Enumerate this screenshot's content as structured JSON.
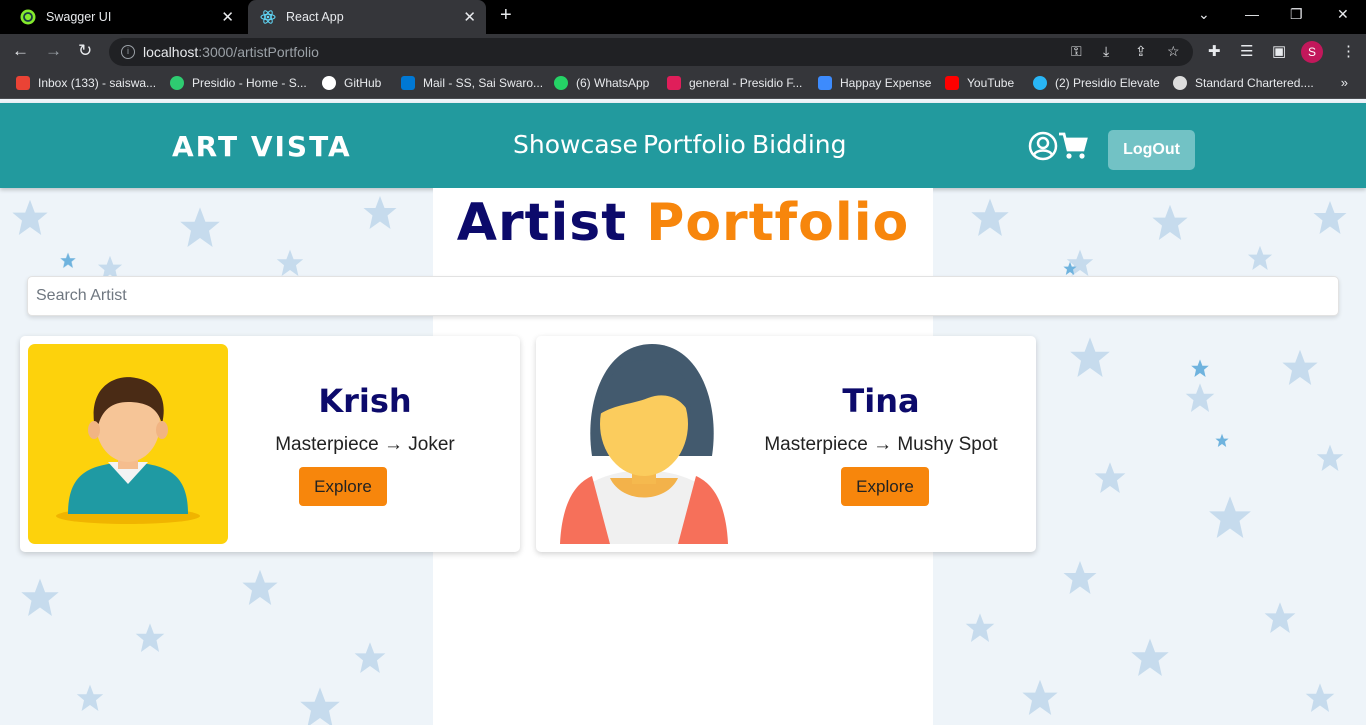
{
  "browser": {
    "tabs": [
      {
        "title": "Swagger UI",
        "close": "✕"
      },
      {
        "title": "React App",
        "close": "✕"
      }
    ],
    "new_tab": "+",
    "window_controls": {
      "dropdown": "⌄",
      "minimize": "—",
      "restore": "❐",
      "close": "✕"
    },
    "url": {
      "host": "localhost",
      "path": ":3000/artistPortfolio"
    },
    "profile_initial": "S",
    "bookmarks": [
      {
        "label": "Inbox (133) - saiswa...",
        "color": "#ea4335"
      },
      {
        "label": "Presidio - Home - S...",
        "color": "#2ecc71"
      },
      {
        "label": "GitHub",
        "color": "#ffffff"
      },
      {
        "label": "Mail - SS, Sai Swaro...",
        "color": "#0078d4"
      },
      {
        "label": "(6) WhatsApp",
        "color": "#25d366"
      },
      {
        "label": "general - Presidio F...",
        "color": "#e01e5a"
      },
      {
        "label": "Happay Expense",
        "color": "#3d8bfd"
      },
      {
        "label": "YouTube",
        "color": "#ff0000"
      },
      {
        "label": "(2) Presidio Elevate",
        "color": "#29b6f6"
      },
      {
        "label": "Standard Chartered....",
        "color": "#dddddd"
      }
    ],
    "bookmarks_more": "»"
  },
  "header": {
    "logo": "ART VISTA",
    "nav": [
      "Showcase",
      "Portfolio",
      "Bidding"
    ],
    "logout_label": "LogOut",
    "color": "#229a9e"
  },
  "page": {
    "title_part1": "Artist",
    "title_part2": "Portfolio",
    "search_placeholder": "Search Artist"
  },
  "artists": [
    {
      "name": "Krish",
      "masterpiece": "Masterpiece → Joker",
      "button": "Explore"
    },
    {
      "name": "Tina",
      "masterpiece": "Masterpiece → Mushy Spot",
      "button": "Explore"
    }
  ],
  "colors": {
    "accent": "#f7860c",
    "title_navy": "#0c0a6b"
  }
}
